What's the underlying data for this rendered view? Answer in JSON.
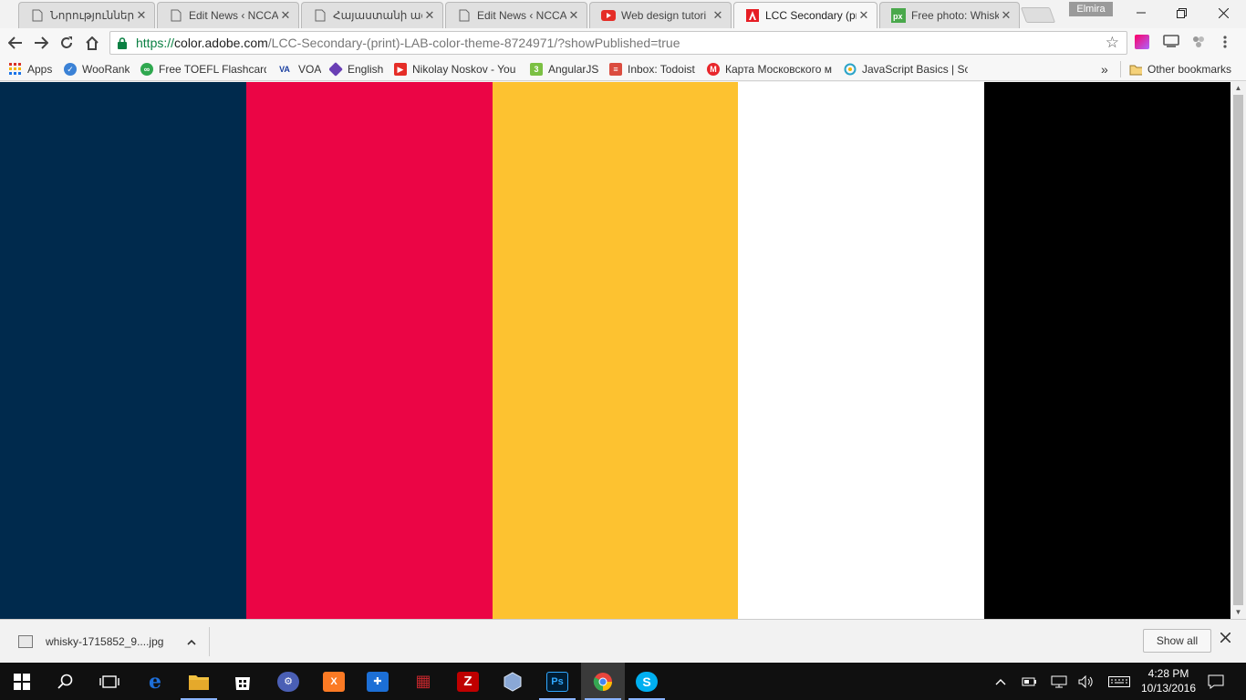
{
  "browser": {
    "tabs": [
      {
        "title": "Նորություններ - ",
        "favicon": "page-icon",
        "active": false
      },
      {
        "title": "Edit News ‹ NCCA",
        "favicon": "page-icon",
        "active": false
      },
      {
        "title": "Հայաստանի ազգ",
        "favicon": "page-icon",
        "active": false
      },
      {
        "title": "Edit News ‹ NCCA",
        "favicon": "page-icon",
        "active": false
      },
      {
        "title": "Web design tutori",
        "favicon": "youtube-icon",
        "active": false
      },
      {
        "title": "LCC Secondary (pr",
        "favicon": "adobe-icon",
        "active": true
      },
      {
        "title": "Free photo: Whisk",
        "favicon": "pixabay-icon",
        "active": false
      }
    ],
    "profile_name": "Elmira",
    "address": {
      "scheme": "https://",
      "host": "color.adobe.com",
      "path": "/LCC-Secondary-(print)-LAB-color-theme-8724971/?showPublished=true"
    },
    "bookmarks": [
      {
        "label": "Apps",
        "icon": "apps-grid-icon",
        "color": "#d93025"
      },
      {
        "label": "WooRank",
        "icon": "woorank-icon",
        "color": "#3b82d6"
      },
      {
        "label": "Free TOEFL Flashcards",
        "icon": "flashcards-icon",
        "color": "#2fa84f"
      },
      {
        "label": "VOA",
        "icon": "voa-icon",
        "color": "#1a3fa0"
      },
      {
        "label": "English",
        "icon": "english-icon",
        "color": "#6a3fb5"
      },
      {
        "label": "Nikolay Noskov - You",
        "icon": "youtube-icon",
        "color": "#e52d27"
      },
      {
        "label": "AngularJS",
        "icon": "angularjs-icon",
        "color": "#7bc043"
      },
      {
        "label": "Inbox: Todoist",
        "icon": "todoist-icon",
        "color": "#db4c3f"
      },
      {
        "label": "Карта Московского м",
        "icon": "metro-icon",
        "color": "#e8262b"
      },
      {
        "label": "JavaScript Basics | Sol",
        "icon": "sololearn-icon",
        "color": "#2aa4c8"
      }
    ],
    "bookmarks_overflow": "»",
    "other_bookmarks": "Other bookmarks"
  },
  "theme": {
    "colors": [
      "#002a4d",
      "#eb0545",
      "#fdc230",
      "#ffffff",
      "#000000"
    ]
  },
  "download_shelf": {
    "file_name": "whisky-1715852_9....jpg",
    "show_all_label": "Show all"
  },
  "taskbar": {
    "apps": [
      {
        "icon": "edge-icon",
        "color": "#1e6fd9",
        "glyph": "e"
      },
      {
        "icon": "file-explorer-icon",
        "color": "#f2c140",
        "glyph": ""
      },
      {
        "icon": "store-icon",
        "color": "#ffffff",
        "glyph": ""
      },
      {
        "icon": "app-blue-icon",
        "color": "#4a5fb5",
        "glyph": "⚙"
      },
      {
        "icon": "xampp-icon",
        "color": "#fb7a24",
        "glyph": "X"
      },
      {
        "icon": "shield-icon",
        "color": "#1c6fd6",
        "glyph": "✚"
      },
      {
        "icon": "app-red-icon",
        "color": "#c0262b",
        "glyph": "▦"
      },
      {
        "icon": "filezilla-icon",
        "color": "#bf0000",
        "glyph": "Z"
      },
      {
        "icon": "virtualbox-icon",
        "color": "#8aa8d6",
        "glyph": "▣"
      },
      {
        "icon": "photoshop-icon",
        "color": "#001d34",
        "glyph": "Ps"
      },
      {
        "icon": "chrome-icon",
        "color": "#e8453c",
        "glyph": "◉"
      },
      {
        "icon": "skype-icon",
        "color": "#00aff0",
        "glyph": "S"
      }
    ],
    "clock_time": "4:28 PM",
    "clock_date": "10/13/2016"
  }
}
